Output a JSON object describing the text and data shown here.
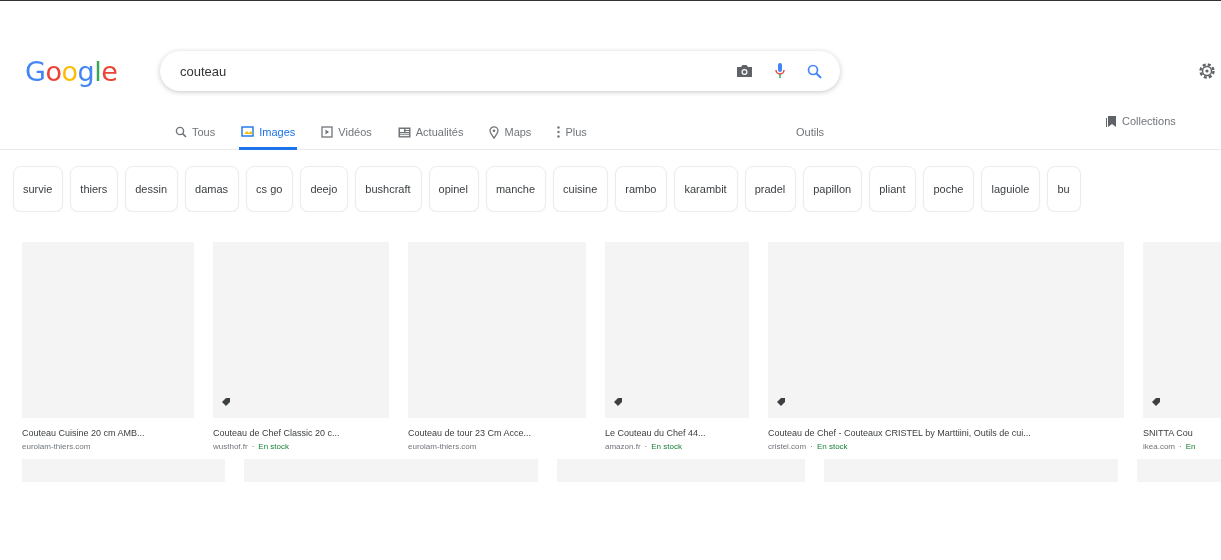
{
  "header": {
    "logo": "Google",
    "search": {
      "value": "couteau"
    }
  },
  "tabs": [
    {
      "label": "Tous",
      "selected": false
    },
    {
      "label": "Images",
      "selected": true
    },
    {
      "label": "Vidéos",
      "selected": false
    },
    {
      "label": "Actualités",
      "selected": false
    },
    {
      "label": "Maps",
      "selected": false
    },
    {
      "label": "Plus",
      "selected": false
    }
  ],
  "tools": "Outils",
  "collections": "Collections",
  "chips": [
    "survie",
    "thiers",
    "dessin",
    "damas",
    "cs go",
    "deejo",
    "bushcraft",
    "opinel",
    "manche",
    "cuisine",
    "rambo",
    "karambit",
    "pradel",
    "papillon",
    "pliant",
    "poche",
    "laguiole",
    "bu"
  ],
  "results": [
    {
      "items": [
        {
          "kind": "thumbnail",
          "tagged": false,
          "title": "Couteau Cuisine 20 cm AMB...",
          "source": "eurolam-thiers.com"
        },
        {
          "kind": "thumbnail",
          "tagged": true,
          "title": "Couteau de Chef Classic 20 c...",
          "source": "wusthof.fr",
          "separator": "·",
          "stock": "En stock"
        },
        {
          "kind": "thumbnail",
          "tagged": false,
          "title": "Couteau de tour 23 Cm Acce...",
          "source": "eurolam-thiers.com"
        },
        {
          "kind": "thumbnail",
          "tagged": true,
          "title": "Le Couteau du Chef 44...",
          "source": "amazon.fr",
          "separator": "·",
          "stock": "En stock"
        },
        {
          "kind": "thumbnail",
          "tagged": true,
          "title": "Couteau de Chef - Couteaux CRISTEL by Marttiini, Outils de cui...",
          "source": "cristel.com",
          "separator": "·",
          "stock": "En stock"
        },
        {
          "kind": "thumbnail",
          "tagged": true,
          "title": "SNITTA Cou",
          "source": "ikea.com",
          "separator": "·",
          "stock": "En"
        }
      ]
    },
    {
      "items": [
        {
          "kind": "thumbnail",
          "tagged": false
        },
        {
          "kind": "thumbnail",
          "tagged": false
        },
        {
          "kind": "thumbnail",
          "tagged": false
        },
        {
          "kind": "thumbnail",
          "tagged": false
        },
        {
          "kind": "thumbnail",
          "tagged": false
        }
      ]
    }
  ]
}
